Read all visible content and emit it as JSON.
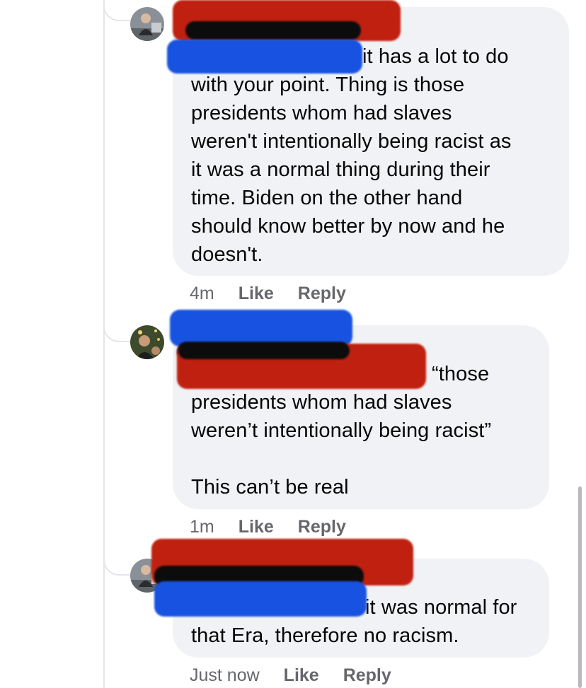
{
  "comments": [
    {
      "author_redacted": true,
      "body_visible_first_line": "it has a lot to do",
      "body_rest": "with your point. Thing is those\npresidents whom had slaves\nweren't intentionally being racist as\nit was a normal thing during their\ntime. Biden on the other hand\nshould know better by now and he\ndoesn't.",
      "time": "4m",
      "like_label": "Like",
      "reply_label": "Reply"
    },
    {
      "author_redacted": true,
      "body_visible_first_line": "“those",
      "body_rest": "presidents whom had slaves\nweren’t intentionally being racist”\n\nThis can’t be real",
      "time": "1m",
      "like_label": "Like",
      "reply_label": "Reply"
    },
    {
      "author_redacted": true,
      "body_visible_first_line": "it was normal for",
      "body_rest": "that Era, therefore no racism.",
      "time": "Just now",
      "like_label": "Like",
      "reply_label": "Reply"
    }
  ],
  "colors": {
    "bubble": "#f0f2f5",
    "meta_text": "#65676b",
    "redaction_red": "#c0200f",
    "redaction_blue": "#1753e0",
    "redaction_black": "#0c0c0c"
  },
  "icons": [
    "avatar-photo",
    "thread-connector"
  ]
}
